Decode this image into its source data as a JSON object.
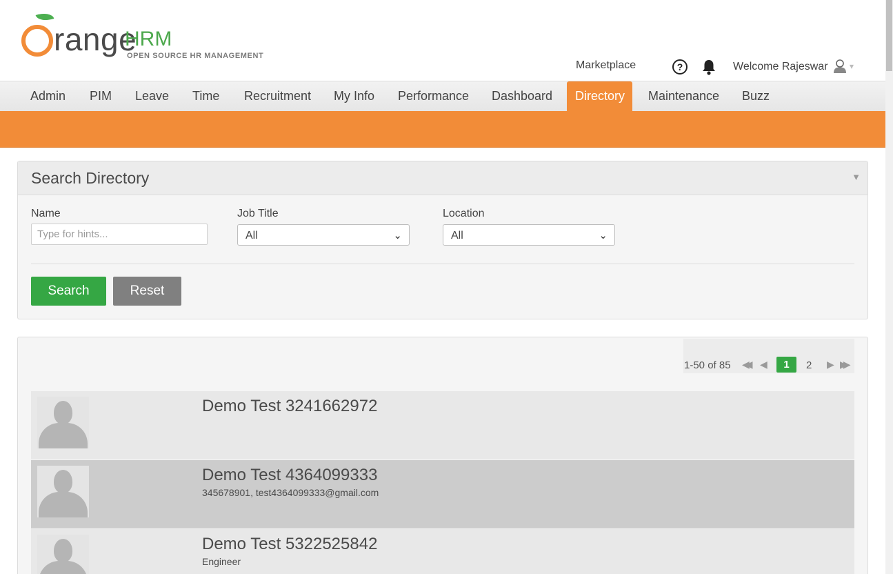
{
  "brand": {
    "word": "range",
    "hrm": "HRM",
    "tagline": "OPEN SOURCE HR MANAGEMENT",
    "orange": "#f28c38",
    "green": "#4ca84c"
  },
  "header": {
    "marketplace": "Marketplace",
    "help": "?",
    "welcome": "Welcome Rajeswar",
    "caret": "▾"
  },
  "nav": {
    "items": [
      "Admin",
      "PIM",
      "Leave",
      "Time",
      "Recruitment",
      "My Info",
      "Performance",
      "Dashboard",
      "Directory",
      "Maintenance",
      "Buzz"
    ],
    "active": "Directory"
  },
  "search": {
    "title": "Search Directory",
    "collapse_glyph": "▼",
    "name_label": "Name",
    "name_placeholder": "Type for hints...",
    "name_value": "",
    "job_title_label": "Job Title",
    "job_title_value": "All",
    "location_label": "Location",
    "location_value": "All",
    "search_button": "Search",
    "reset_button": "Reset",
    "chevron": "⌄"
  },
  "pager": {
    "count": "1-50 of 85",
    "first": "◀◀",
    "prev": "◀",
    "current": "1",
    "next_page": "2",
    "next": "▶",
    "last": "▶▶"
  },
  "employees": [
    {
      "name": "Demo Test 3241662972",
      "sub": ""
    },
    {
      "name": "Demo Test 4364099333",
      "sub": "345678901, test4364099333@gmail.com"
    },
    {
      "name": "Demo Test 5322525842",
      "sub": "Engineer"
    }
  ]
}
